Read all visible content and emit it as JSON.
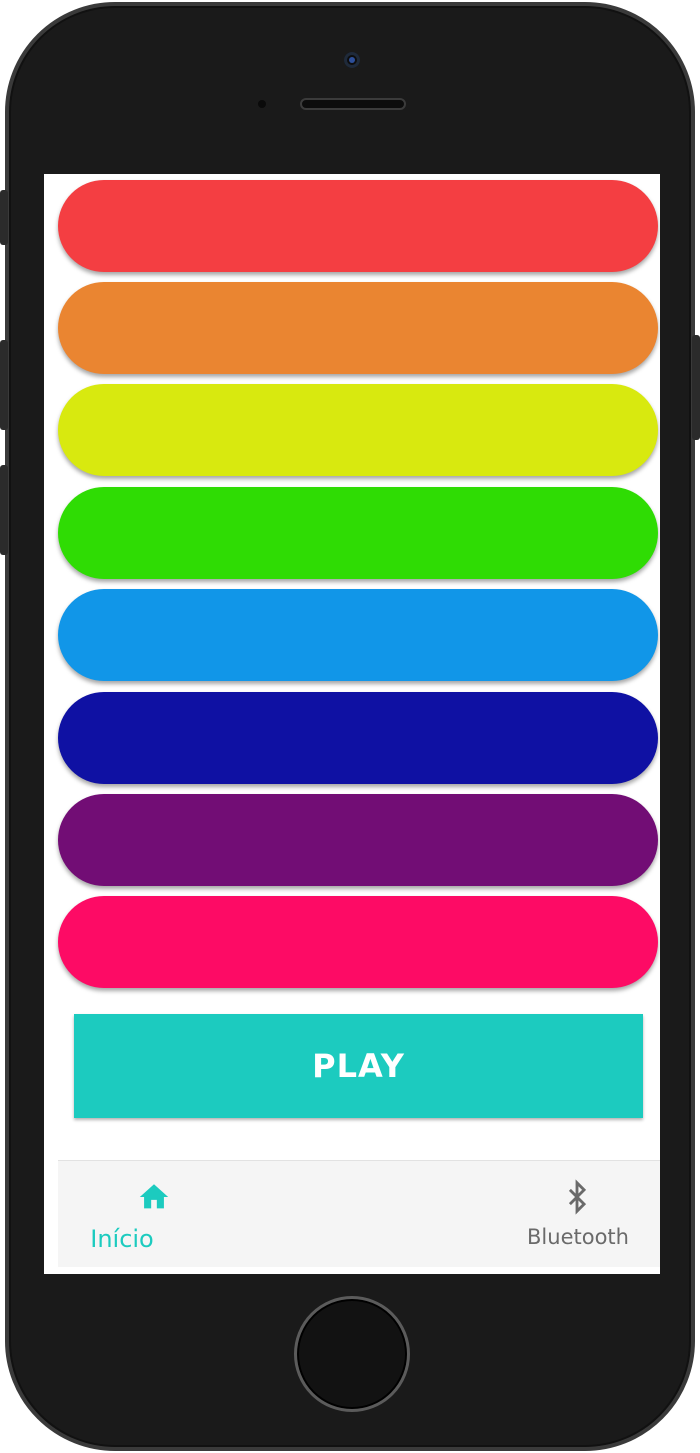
{
  "colors": {
    "bars": [
      "#f43e42",
      "#ea8531",
      "#d8e90f",
      "#2fdc04",
      "#1196e8",
      "#0f11a3",
      "#720d75",
      "#fd0b65"
    ],
    "accent": "#1ccbbf",
    "inactive": "#6a6a6a"
  },
  "main": {
    "play_label": "PLAY"
  },
  "bottom_nav": {
    "items": [
      {
        "label": "Início",
        "icon": "home-icon",
        "active": true
      },
      {
        "label": "Bluetooth",
        "icon": "bluetooth-icon",
        "active": false
      }
    ]
  }
}
